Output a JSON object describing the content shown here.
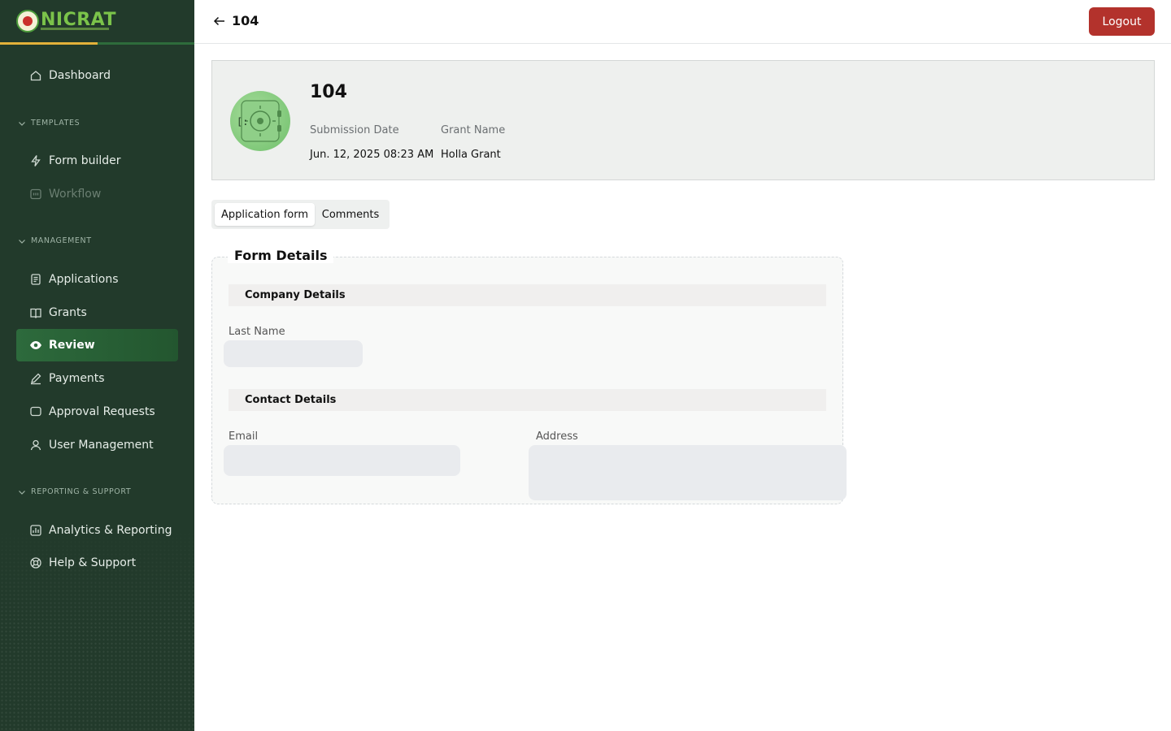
{
  "brand": {
    "name": "NICRAT"
  },
  "sidebar": {
    "items": [
      {
        "label": "Dashboard"
      },
      {
        "label": "Form builder"
      },
      {
        "label": "Workflow"
      },
      {
        "label": "Applications"
      },
      {
        "label": "Grants"
      },
      {
        "label": "Review"
      },
      {
        "label": "Payments"
      },
      {
        "label": "Approval Requests"
      },
      {
        "label": "User Management"
      },
      {
        "label": "Analytics & Reporting"
      },
      {
        "label": "Help & Support"
      }
    ],
    "sections": [
      "TEMPLATES",
      "MANAGEMENT",
      "REPORTING & SUPPORT"
    ],
    "active": "Review"
  },
  "topbar": {
    "title": "104",
    "logout_label": "Logout"
  },
  "record": {
    "title": "104",
    "submission_date_label": "Submission Date",
    "submission_date": "Jun. 12, 2025 08:23 AM",
    "grant_name_label": "Grant Name",
    "grant_name": "Holla Grant"
  },
  "tabs": [
    {
      "label": "Application form",
      "active": true
    },
    {
      "label": "Comments",
      "active": false
    }
  ],
  "form": {
    "legend": "Form Details",
    "company_section": "Company Details",
    "last_name_label": "Last Name",
    "contact_section": "Contact Details",
    "email_label": "Email",
    "address_label": "Address"
  },
  "colors": {
    "sidebar_bg": "#223a2b",
    "active_item": "#2d6a3c",
    "logout": "#b3322c",
    "accent": "#e3b13a"
  },
  "icons": [
    "home-icon",
    "lightning-icon",
    "workflow-icon",
    "document-icon",
    "book-icon",
    "eye-icon",
    "pen-icon",
    "chat-icon",
    "user-icon",
    "chart-icon",
    "help-icon",
    "arrow-left-icon",
    "chevron-down-icon"
  ]
}
